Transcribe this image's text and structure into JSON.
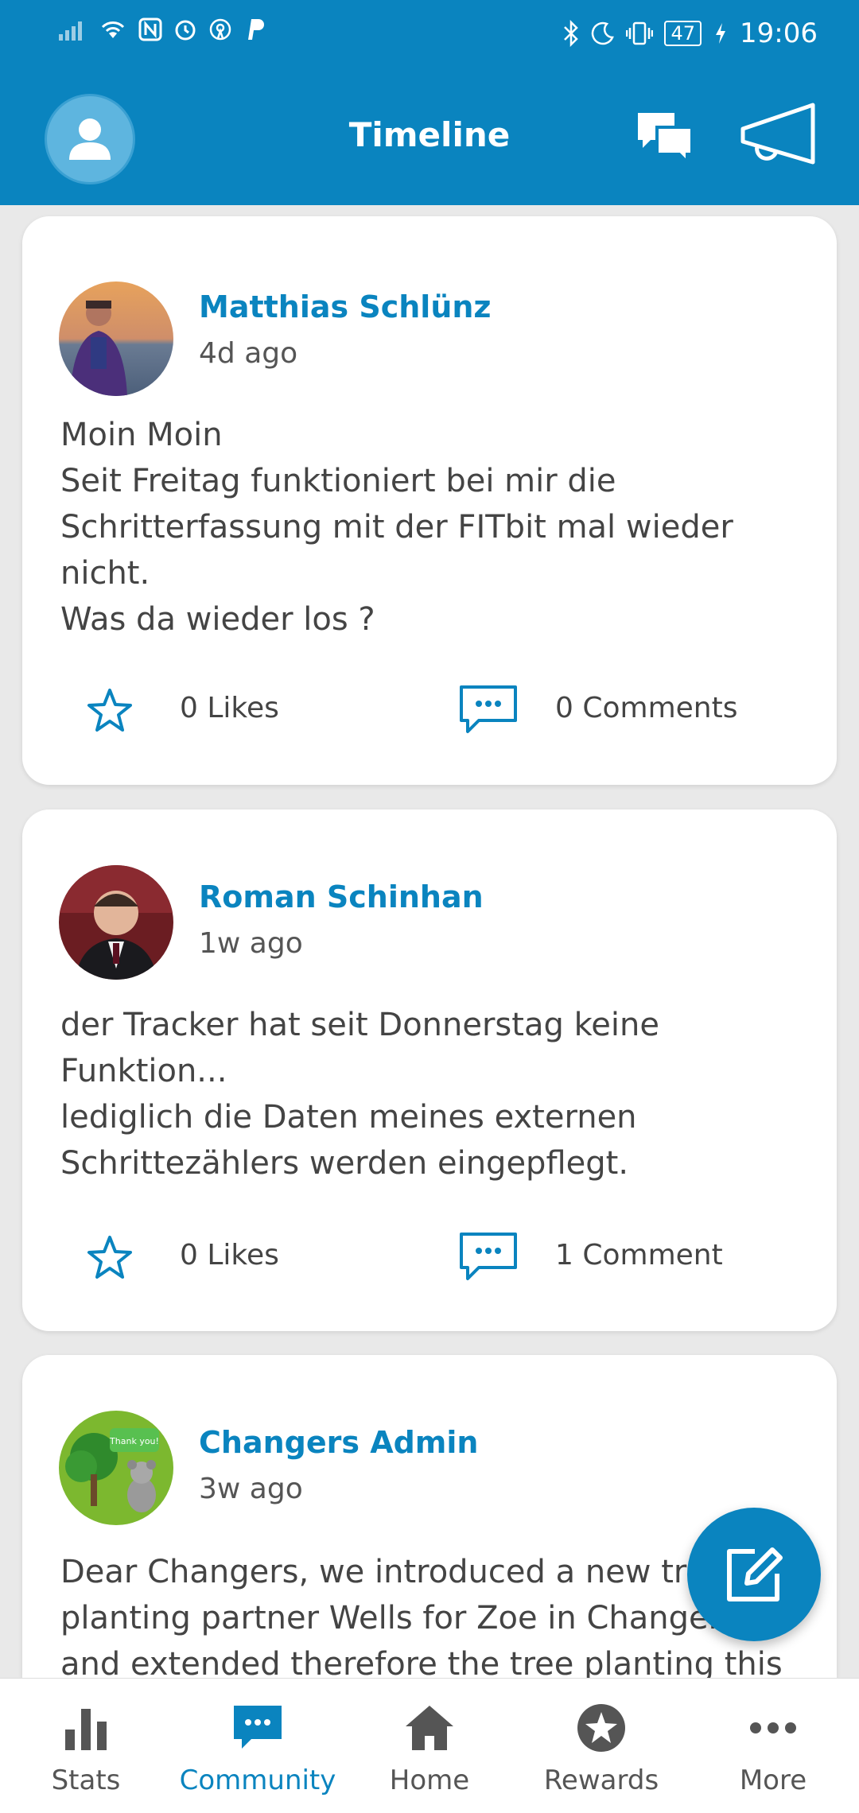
{
  "status_bar": {
    "time": "19:06",
    "battery": "47"
  },
  "header": {
    "title": "Timeline",
    "icons": [
      "profile-icon",
      "chat-icon",
      "megaphone-icon"
    ]
  },
  "posts": [
    {
      "author": "Matthias Schlünz",
      "time_ago": "4d ago",
      "text": "Moin Moin\nSeit Freitag funktioniert bei mir die Schritterfassung mit der FITbit mal wieder nicht.\nWas da wieder los ?",
      "likes_label": "0 Likes",
      "comments_label": "0 Comments"
    },
    {
      "author": "Roman Schinhan",
      "time_ago": "1w ago",
      "text": "der Tracker hat seit Donnerstag keine Funktion...\nlediglich die Daten meines externen Schrittezählers werden eingepflegt.",
      "likes_label": "0 Likes",
      "comments_label": "1 Comment"
    },
    {
      "author": "Changers Admin",
      "time_ago": "3w ago",
      "avatar_caption": "Thank you!",
      "text": "Dear Changers, we introduced a new tree planting partner Wells for Zoe in Changers and extended therefore the tree planting this year"
    }
  ],
  "bottom_nav": [
    {
      "label": "Stats",
      "icon": "bar-chart-icon"
    },
    {
      "label": "Community",
      "icon": "chat-bubble-icon",
      "active": true
    },
    {
      "label": "Home",
      "icon": "home-icon"
    },
    {
      "label": "Rewards",
      "icon": "star-badge-icon"
    },
    {
      "label": "More",
      "icon": "more-dots-icon"
    }
  ],
  "colors": {
    "primary": "#0a84bf",
    "background": "#e9e9e9",
    "card": "#ffffff"
  }
}
